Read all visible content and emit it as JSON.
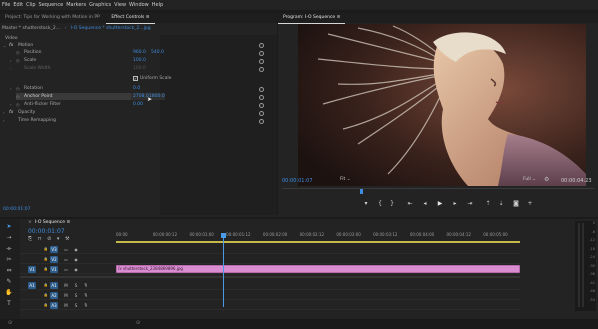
{
  "menu": [
    "File",
    "Edit",
    "Clip",
    "Sequence",
    "Markers",
    "Graphics",
    "View",
    "Window",
    "Help"
  ],
  "left_tabs": {
    "project": "Project: Tips for Working with Motion in PP",
    "effect_controls": "Effect Controls",
    "menu_glyph": "≡"
  },
  "effect_controls": {
    "master": "Master * shutterstock_2...",
    "sequence": "I-O Sequence * shutterstock_2...jpg",
    "video_label": "Video",
    "motion": "Motion",
    "position": {
      "label": "Position",
      "x": "960.0",
      "y": "540.0"
    },
    "scale": {
      "label": "Scale",
      "value": "100.0"
    },
    "scale_width": {
      "label": "Scale Width",
      "value": "100.0"
    },
    "uniform_scale": {
      "label": "Uniform Scale",
      "checked": true
    },
    "rotation": {
      "label": "Rotation",
      "value": "0.0"
    },
    "anchor_point": {
      "label": "Anchor Point",
      "x": "2708.0",
      "y": "1800.0"
    },
    "anti_flicker": {
      "label": "Anti-flicker Filter",
      "value": "0.00"
    },
    "opacity": "Opacity",
    "time_remapping": "Time Remapping",
    "fx": "fx",
    "timecode": "00:00:01:07"
  },
  "program": {
    "title": "Program: I-O Sequence",
    "timecode": "00:00:01:07",
    "fit": "Fit",
    "full": "Full",
    "duration": "00:00:04:23"
  },
  "timeline": {
    "tab": "I-O Sequence",
    "timecode": "00:00:01:07",
    "ruler": [
      "00:00",
      "00:00:00:12",
      "00:00:01:00",
      "00:00:01:12",
      "00:00:02:00",
      "00:00:02:12",
      "00:00:03:00",
      "00:00:03:12",
      "00:00:04:00",
      "00:00:04:12",
      "00:00:05:00"
    ],
    "video_tracks": [
      "V3",
      "V2",
      "V1"
    ],
    "audio_tracks": [
      "A1",
      "A2",
      "A3"
    ],
    "source_v": "V1",
    "source_a": "A1",
    "clip_name": "shutterstock_2384869896.jpg",
    "playhead_fraction": 0.265
  },
  "colors": {
    "clip": "#d98cd0",
    "accent": "#3f8de0",
    "playhead": "#4a9ae8",
    "work_area": "#c7b84a"
  },
  "meter_labels": [
    "0",
    "-6",
    "-12",
    "-18",
    "-24",
    "-30",
    "-36",
    "-42",
    "-48",
    "-54"
  ]
}
